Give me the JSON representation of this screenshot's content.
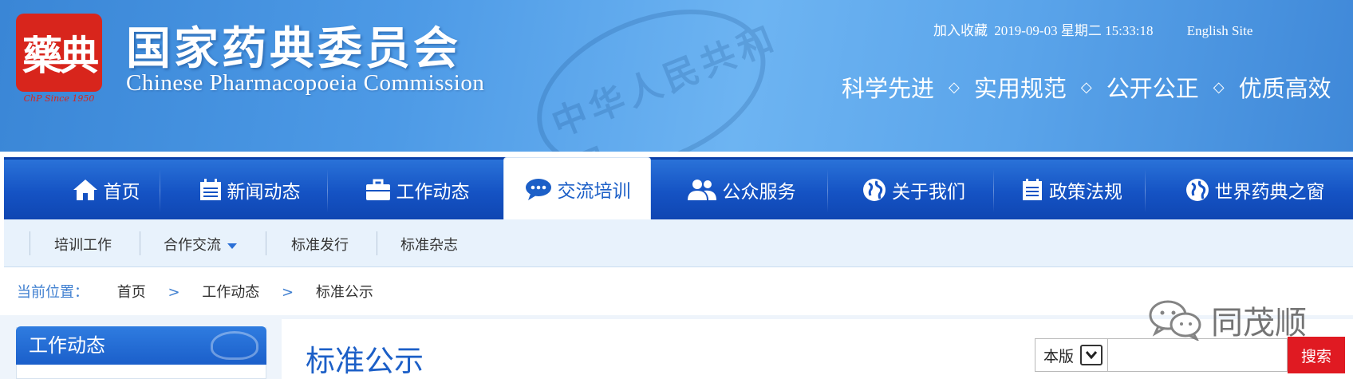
{
  "header": {
    "logo_text": "藥典",
    "logo_caption": "ChP Since 1950",
    "title_cn": "国家药典委员会",
    "title_en": "Chinese Pharmacopoeia Commission",
    "bookmark": "加入收藏",
    "datetime": "2019-09-03 星期二 15:33:18",
    "english_site": "English Site",
    "slogans": [
      "科学先进",
      "实用规范",
      "公开公正",
      "优质高效"
    ],
    "slogan_separator": "◇",
    "watermark_text": "中华人民共和国"
  },
  "nav": {
    "items": [
      {
        "label": "首页",
        "icon": "home-icon"
      },
      {
        "label": "新闻动态",
        "icon": "calendar-icon"
      },
      {
        "label": "工作动态",
        "icon": "briefcase-icon"
      },
      {
        "label": "交流培训",
        "icon": "chat-icon",
        "active": true
      },
      {
        "label": "公众服务",
        "icon": "users-icon"
      },
      {
        "label": "关于我们",
        "icon": "globe-icon"
      },
      {
        "label": "政策法规",
        "icon": "document-icon"
      },
      {
        "label": "世界药典之窗",
        "icon": "globe-icon"
      }
    ]
  },
  "subnav": {
    "items": [
      "培训工作",
      "合作交流",
      "标准发行",
      "标准杂志"
    ]
  },
  "breadcrumb": {
    "label": "当前位置：",
    "separator": ">",
    "items": [
      "首页",
      "工作动态",
      "标准公示"
    ]
  },
  "sidebar": {
    "title": "工作动态"
  },
  "main": {
    "section_title": "标准公示"
  },
  "search": {
    "scope": "本版",
    "button": "搜索",
    "placeholder": ""
  },
  "watermark": {
    "name": "同茂顺"
  },
  "colors": {
    "nav_blue": "#1553c4",
    "accent_blue": "#1c5fc7",
    "search_red": "#e01a22",
    "logo_red": "#d8251c"
  }
}
